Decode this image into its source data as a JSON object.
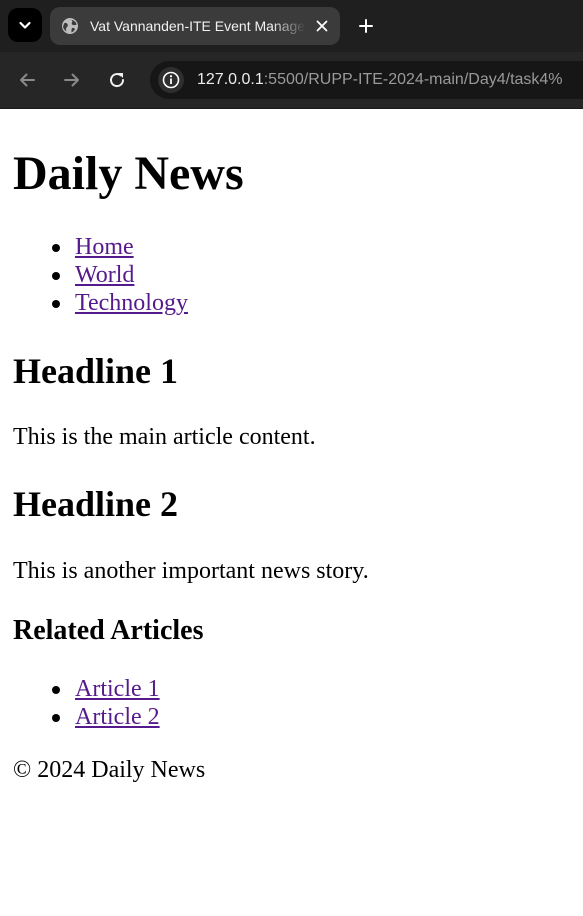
{
  "browser": {
    "tab": {
      "title": "Vat Vannanden-ITE Event Manager"
    },
    "address_bar": {
      "host": "127.0.0.1",
      "path": ":5500/RUPP-ITE-2024-main/Day4/task4%"
    }
  },
  "page": {
    "site_title": "Daily News",
    "nav": [
      {
        "label": "Home"
      },
      {
        "label": "World"
      },
      {
        "label": "Technology"
      }
    ],
    "articles": [
      {
        "headline": "Headline 1",
        "body": "This is the main article content."
      },
      {
        "headline": "Headline 2",
        "body": "This is another important news story."
      }
    ],
    "related": {
      "title": "Related Articles",
      "links": [
        {
          "label": "Article 1"
        },
        {
          "label": "Article 2"
        }
      ]
    },
    "footer": {
      "text": "© 2024 Daily News"
    }
  },
  "colors": {
    "link_visited": "#551a8b",
    "tabbar_bg": "#1f1f1f",
    "toolbar_bg": "#262626"
  }
}
